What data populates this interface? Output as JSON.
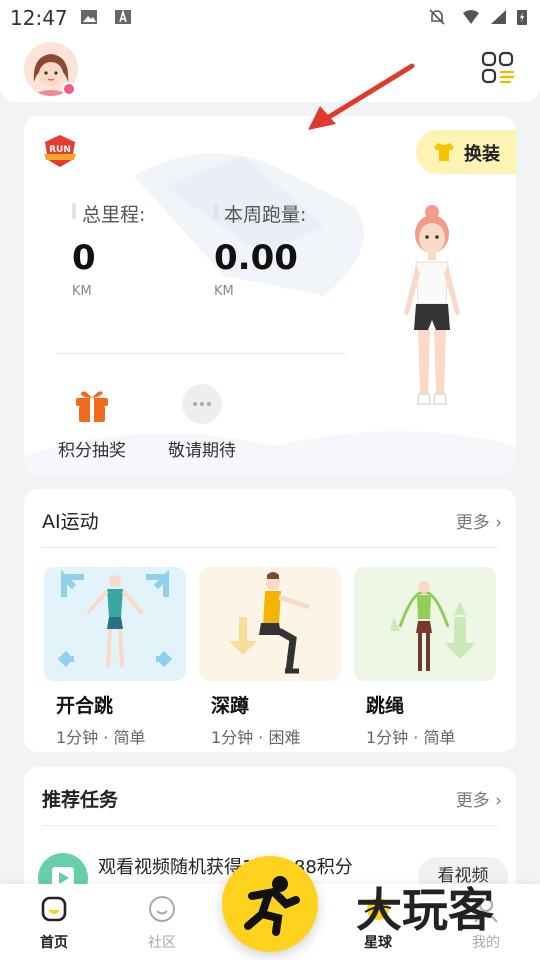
{
  "status_bar": {
    "time": "12:47"
  },
  "run_card": {
    "badge_text": "RUN",
    "dress_button": "换装",
    "total_label": "总里程:",
    "total_value": "0",
    "total_unit": "KM",
    "week_label": "本周跑量:",
    "week_value": "0.00",
    "week_unit": "KM",
    "actions": [
      {
        "label": "积分抽奖",
        "icon": "gift-icon"
      },
      {
        "label": "敬请期待",
        "icon": "more-dots-icon"
      }
    ]
  },
  "ai_section": {
    "title": "AI运动",
    "more": "更多",
    "exercises": [
      {
        "name": "开合跳",
        "meta": "1分钟 · 简单"
      },
      {
        "name": "深蹲",
        "meta": "1分钟 · 困难"
      },
      {
        "name": "跳绳",
        "meta": "1分钟 · 简单"
      }
    ]
  },
  "tasks_section": {
    "title": "推荐任务",
    "more": "更多",
    "task_text": "观看视频随机获得188/388积分",
    "task_button": "看视频"
  },
  "nav": [
    {
      "label": "首页",
      "icon": "home-icon",
      "active": true
    },
    {
      "label": "社区",
      "icon": "community-icon",
      "active": false
    },
    {
      "label": "星球",
      "icon": "planet-icon",
      "active": true
    },
    {
      "label": "我的",
      "icon": "profile-icon",
      "active": false
    }
  ],
  "watermark": "大玩客",
  "colors": {
    "accent": "#ffd21e",
    "orange": "#f26b1d",
    "background": "#f2f3f5"
  }
}
